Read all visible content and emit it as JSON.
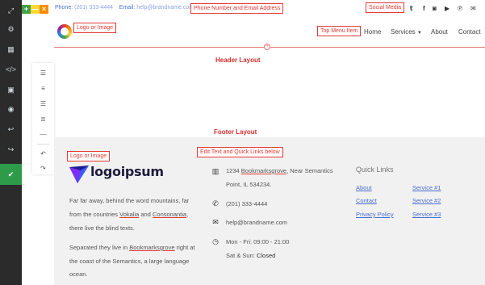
{
  "editor": {
    "sidebar_icons": [
      "expand-icon",
      "gear-icon",
      "grid-icon",
      "code-icon",
      "image-icon",
      "eye-icon",
      "undo-icon",
      "redo-icon",
      "save-icon"
    ],
    "window_buttons": [
      "+",
      "—",
      "×"
    ],
    "colors": {
      "sidebar": "#2b2b2b",
      "active": "#2e9b4a",
      "green": "#43a047",
      "yellow": "#fdd835",
      "orange": "#fb8c00"
    }
  },
  "topbar": {
    "phone_label": "Phone:",
    "phone_value": "(201) 333-4444",
    "email_label": "Email:",
    "email_value": "help@brandname.com",
    "annotation_contact": "Phone Number and Email Address",
    "annotation_social": "Social Media",
    "social_icons": [
      "twitter-icon",
      "facebook-icon",
      "instagram-icon",
      "youtube-icon",
      "pinterest-icon",
      "mail-icon"
    ]
  },
  "header": {
    "annotation_logo": "Logo or Image",
    "annotation_menu": "Top Menu Item",
    "nav": {
      "home": "Home",
      "services": "Services",
      "about": "About",
      "contact": "Contact"
    },
    "section_label": "Header Layout"
  },
  "vertical_toolbar": {
    "icons": [
      "align-left-icon",
      "align-center-icon",
      "align-right-icon",
      "align-justify-icon",
      "horizontal-rule-icon",
      "undo-icon",
      "redo-icon"
    ]
  },
  "footer": {
    "section_label": "Footer Layout",
    "annotation_logo": "Logo or Image",
    "annotation_edit": "Edit Text and Quick Links below",
    "logo_text": "logoipsum",
    "about": {
      "line1": "Far far away, behind the word mountains, far",
      "line2_a": "from the countries ",
      "line2_b": "Vokalia",
      "line2_c": " and ",
      "line2_d": "Consonantia",
      "line2_e": ",",
      "line3": "there live the blind texts.",
      "line4_a": "Separated they live in ",
      "line4_b": "Bookmarksgrove",
      "line4_c": " right at",
      "line5": "the coast of the Semantics, a large language",
      "line6": "ocean."
    },
    "address": {
      "line1_a": "1234 ",
      "line1_b": "Bookmarksgrove",
      "line1_c": ", Near Semantics",
      "line2": "Point, IL 534234."
    },
    "phone": "(201) 333-4444",
    "email": "help@brandname.com",
    "hours_line1": "Mon - Fri: 09:00 - 21:00",
    "hours_line2_a": "Sat & Sun: ",
    "hours_line2_b": "Closed",
    "quick_links_title": "Quick Links",
    "quick_links_col1": [
      "About",
      "Contact",
      "Privacy Policy"
    ],
    "quick_links_col2": [
      "Service #1",
      "Service #2",
      "Service #3"
    ]
  }
}
